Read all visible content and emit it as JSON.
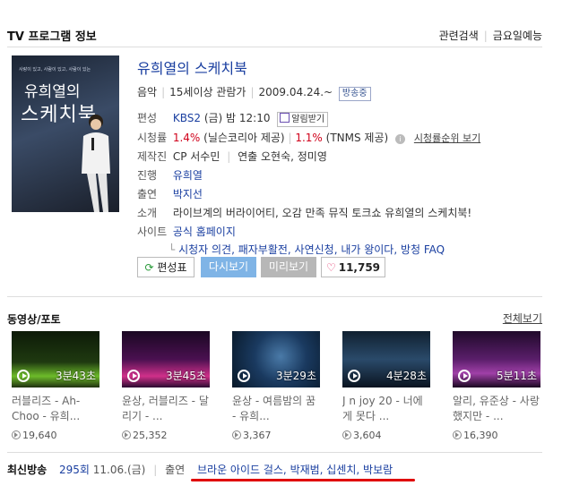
{
  "header": {
    "title": "TV 프로그램 정보",
    "related_search": "관련검색",
    "friday_ent": "금요일예능"
  },
  "poster": {
    "tagline": "사랑이 있고, 사람이 있고, 사람이 있는",
    "line1": "유희열의",
    "line2": "스케치북"
  },
  "program": {
    "title": "유희열의 스케치북",
    "genre": "음악",
    "rating": "15세이상 관람가",
    "start_date": "2009.04.24.~",
    "status_badge": "방송중",
    "rows": {
      "schedule_label": "편성",
      "channel": "KBS2",
      "time": "(금) 밤 12:10",
      "alarm_label": "알림받기",
      "ratings_label": "시청률",
      "rating1_value": "1.4%",
      "rating1_source": "(닐슨코리아 제공)",
      "rating2_value": "1.1%",
      "rating2_source": "(TNMS 제공)",
      "ratings_rank_link": "시청률순위 보기",
      "production_label": "제작진",
      "cp": "CP 서수민",
      "director": "연출 오현숙, 정미영",
      "host_label": "진행",
      "host": "유희열",
      "cast_label": "출연",
      "cast": "박지선",
      "intro_label": "소개",
      "intro": "라이브계의 버라이어티, 오감 만족 뮤직 토크쇼 유희열의 스케치북!",
      "site_label": "사이트",
      "site_link": "공식 홈페이지",
      "sub_links": "시청자 의견, 패자부활전, 사연신청, 내가 왕이다, 방청 FAQ"
    }
  },
  "buttons": {
    "schedule": "편성표",
    "replay": "다시보기",
    "preview": "미리보기",
    "likes": "11,759"
  },
  "clips_section": {
    "title": "동영상/포토",
    "more": "전체보기",
    "items": [
      {
        "duration": "3분43초",
        "title": "러블리즈 - Ah-Choo - 유희...",
        "views": "19,640"
      },
      {
        "duration": "3분45초",
        "title": "윤상, 러블리즈 - 달리기 - ...",
        "views": "25,352"
      },
      {
        "duration": "3분29초",
        "title": "윤상 - 여름밤의 꿈 - 유희...",
        "views": "3,367"
      },
      {
        "duration": "4분28초",
        "title": "J n joy 20 - 너에게 못다 ...",
        "views": "3,604"
      },
      {
        "duration": "5분11초",
        "title": "알리, 유준상 - 사랑했지만 - ...",
        "views": "16,390"
      }
    ]
  },
  "latest": {
    "label": "최신방송",
    "episode": "295회",
    "date": "11.06.(금)",
    "cast_label": "출연",
    "cast": "브라운 아이드 걸스, 박재범, 십센치, 박보람"
  }
}
